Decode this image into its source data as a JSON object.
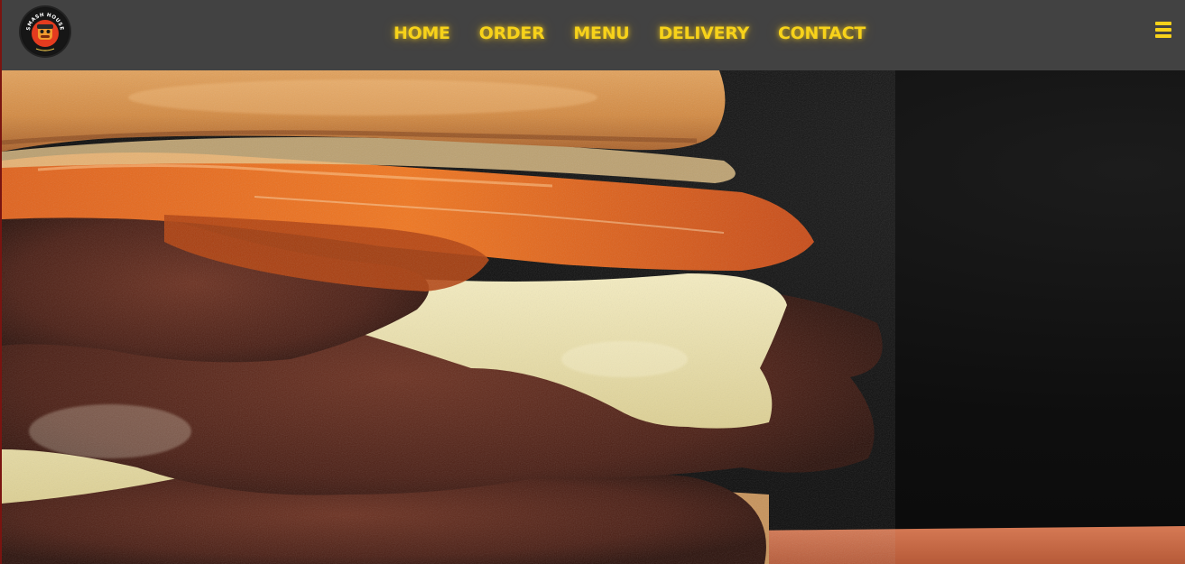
{
  "brand": {
    "logo_icon": "smash-house-mascot-logo",
    "logo_text_top": "SMASH HOUSE",
    "accent_color": "#f7d21a",
    "header_bg": "#424242"
  },
  "nav": {
    "items": [
      {
        "label": "HOME"
      },
      {
        "label": "ORDER"
      },
      {
        "label": "MENU"
      },
      {
        "label": "DELIVERY"
      },
      {
        "label": "CONTACT"
      }
    ],
    "menu_icon": "hamburger-menu-icon"
  },
  "hero": {
    "image": "smash-burger-closeup-photo"
  }
}
